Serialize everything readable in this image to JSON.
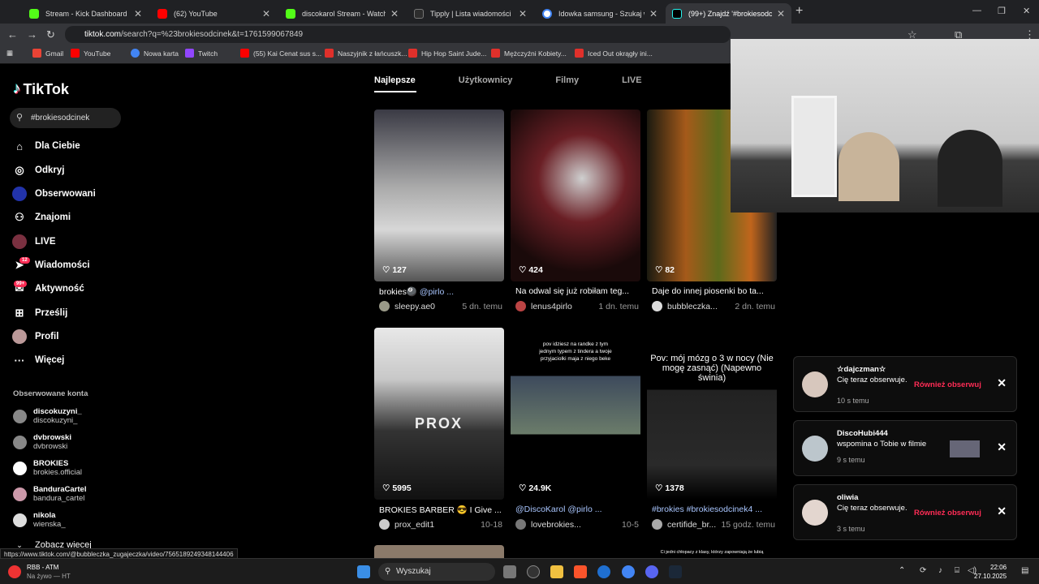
{
  "browser": {
    "tabs": [
      {
        "label": "Stream - Kick Dashboard",
        "color": "#53fc18"
      },
      {
        "label": "(62) YouTube",
        "color": "#ff0000"
      },
      {
        "label": "discokarol Stream - Watch Live",
        "color": "#53fc18"
      },
      {
        "label": "Tipply | Lista wiadomości",
        "color": "#2d2d2d"
      },
      {
        "label": "Idowka samsung - Szukaj w Go",
        "color": "#4285f4"
      },
      {
        "label": "(99+) Znajdź '#brokiesodcinek'",
        "color": "#000000"
      }
    ],
    "url_host": "tiktok.com",
    "url_path": "/search?q=%23brokiesodcinek&t=1761599067849",
    "bookmarks": [
      {
        "label": "Gmail",
        "color": "#ea4335"
      },
      {
        "label": "YouTube",
        "color": "#ff0000"
      },
      {
        "label": "Nowa karta",
        "color": "#4285f4"
      },
      {
        "label": "Twitch",
        "color": "#9146ff"
      },
      {
        "label": "(55) Kai Cenat sus s...",
        "color": "#ff0000"
      },
      {
        "label": "Naszyjnik z łańcuszk...",
        "color": "#e0302b"
      },
      {
        "label": "Hip Hop Saint Jude...",
        "color": "#e0302b"
      },
      {
        "label": "Mężczyźni Kobiety...",
        "color": "#e0302b"
      },
      {
        "label": "Iced Out okrągły ini...",
        "color": "#e0302b"
      }
    ]
  },
  "tiktok": {
    "logo": "TikTok",
    "search_value": "#brokiesodcinek",
    "nav": [
      {
        "label": "Dla Ciebie",
        "icon": "home-icon"
      },
      {
        "label": "Odkryj",
        "icon": "compass-icon"
      },
      {
        "label": "Obserwowani",
        "icon": "following-avatar"
      },
      {
        "label": "Znajomi",
        "icon": "friends-icon"
      },
      {
        "label": "LIVE",
        "icon": "live-avatar"
      },
      {
        "label": "Wiadomości",
        "icon": "messages-icon",
        "badge": "12"
      },
      {
        "label": "Aktywność",
        "icon": "activity-icon",
        "badge": "99+"
      },
      {
        "label": "Prześlij",
        "icon": "upload-icon"
      },
      {
        "label": "Profil",
        "icon": "profile-avatar"
      },
      {
        "label": "Więcej",
        "icon": "more-icon"
      }
    ],
    "followed_title": "Obserwowane konta",
    "followed": [
      {
        "name": "discokuzyni_",
        "handle": "discokuzyni_"
      },
      {
        "name": "dvbrowski",
        "handle": "dvbrowski"
      },
      {
        "name": "BROKIES",
        "handle": "brokies.official"
      },
      {
        "name": "BanduraCartel",
        "handle": "bandura_cartel"
      },
      {
        "name": "nikola",
        "handle": "wienska_"
      }
    ],
    "see_more": "Zobacz wiecej",
    "tabs": [
      "Najlepsze",
      "Użytkownicy",
      "Filmy",
      "LIVE"
    ],
    "videos": [
      {
        "likes": "127",
        "caption": "brokies🎱 ",
        "mention": "@pirlo ...",
        "author": "sleepy.ae0",
        "time": "5 dn. temu"
      },
      {
        "likes": "424",
        "caption": "Na odwal się już robiłam teg...",
        "mention": "",
        "author": "lenus4pirlo",
        "time": "1 dn. temu"
      },
      {
        "likes": "82",
        "caption": "Daje do innej piosenki bo ta...",
        "mention": "",
        "author": "bubbleczka...",
        "time": "2 dn. temu"
      },
      {
        "likes": "5995",
        "caption": "BROKIES BARBER 😎 I Give ...",
        "mention": "",
        "author": "prox_edit1",
        "time": "10-18",
        "overlay": "PROX"
      },
      {
        "likes": "24.9K",
        "caption": "",
        "mention": "@DiscoKarol @pirlo ...",
        "author": "lovebrokies...",
        "time": "10-5",
        "overlay": "pov idziesz na randke z tym jednym typem z tindera a twoje przyjaciolki maja z niego beke"
      },
      {
        "likes": "1378",
        "caption": "",
        "mention": "#brokies #brokiesodcinek4 ...",
        "author": "certifide_br...",
        "time": "15 godz. temu",
        "overlay": "Pov: mój mózg o 3 w nocy (Nie mogę zasnąć) (Napewno świnia)"
      }
    ],
    "bottom_overlay": "Ci jedni chłopacy z klasy, którzy zapowniają że lubią"
  },
  "notifications": [
    {
      "name": "☆dajczman☆",
      "text": "Cię teraz obserwuje.",
      "time": "10 s temu",
      "action": "Również obserwuj"
    },
    {
      "name": "DiscoHubi444",
      "text": "wspomina o Tobie w filmie",
      "time": "9 s temu",
      "action": ""
    },
    {
      "name": "oliwia",
      "text": "Cię teraz obserwuje.",
      "time": "3 s temu",
      "action": "Również obserwuj"
    }
  ],
  "status_url": "https://www.tiktok.com/@bubbleczka_zugajeczka/video/7565189249348144406",
  "taskbar": {
    "weather_title": "RBB - ATM",
    "weather_sub": "Na żywo — HT",
    "search_placeholder": "Wyszukaj",
    "time": "22:06",
    "date": "27.10.2025"
  }
}
